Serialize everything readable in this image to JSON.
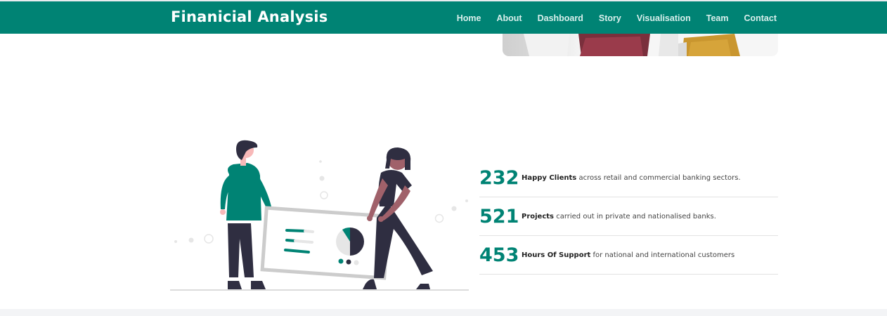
{
  "brand": {
    "title": "Finanicial Analysis"
  },
  "nav": {
    "items": [
      "Home",
      "About",
      "Dashboard",
      "Story",
      "Visualisation",
      "Team",
      "Contact"
    ]
  },
  "stats": [
    {
      "number": "232",
      "label": "Happy Clients",
      "description": "across retail and commercial banking sectors."
    },
    {
      "number": "521",
      "label": "Projects",
      "description": "carried out in private and nationalised banks."
    },
    {
      "number": "453",
      "label": "Hours Of Support",
      "description": "for national and international customers"
    }
  ],
  "colors": {
    "accent": "#008374",
    "dark": "#2f2e41",
    "skin": "#a0616a"
  }
}
